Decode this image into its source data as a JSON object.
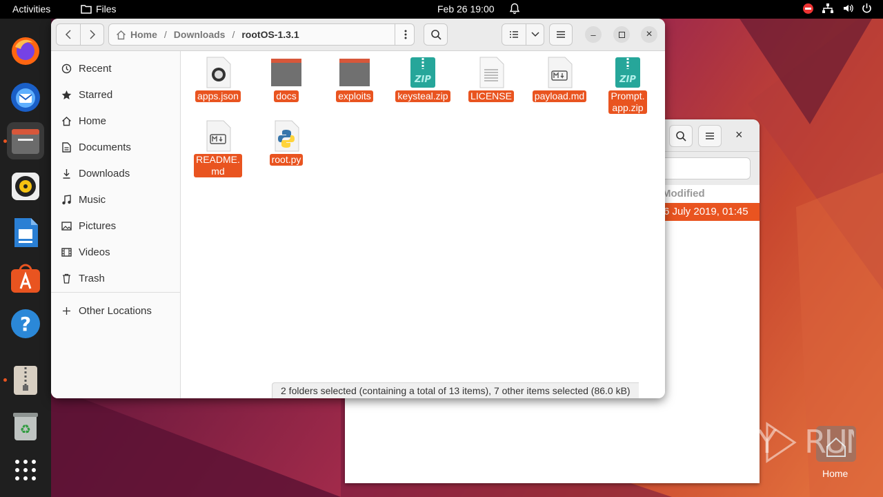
{
  "topbar": {
    "activities": "Activities",
    "app_name": "Files",
    "clock": "Feb 26  19:00"
  },
  "window": {
    "path": [
      {
        "label": "Home"
      },
      {
        "label": "Downloads"
      },
      {
        "label": "rootOS-1.3.1"
      }
    ],
    "sidebar": [
      {
        "label": "Recent",
        "icon": "clock-icon"
      },
      {
        "label": "Starred",
        "icon": "star-icon"
      },
      {
        "label": "Home",
        "icon": "home-icon"
      },
      {
        "label": "Documents",
        "icon": "document-icon"
      },
      {
        "label": "Downloads",
        "icon": "download-icon"
      },
      {
        "label": "Music",
        "icon": "music-icon"
      },
      {
        "label": "Pictures",
        "icon": "picture-icon"
      },
      {
        "label": "Videos",
        "icon": "video-icon"
      },
      {
        "label": "Trash",
        "icon": "trash-icon"
      }
    ],
    "other_locations": "Other Locations",
    "files": [
      {
        "name": "apps.json",
        "type": "json"
      },
      {
        "name": "docs",
        "type": "folder"
      },
      {
        "name": "exploits",
        "type": "folder"
      },
      {
        "name": "keysteal.zip",
        "type": "zip"
      },
      {
        "name": "LICENSE",
        "type": "text"
      },
      {
        "name": "payload.md",
        "type": "markdown"
      },
      {
        "name": "Prompt.\napp.zip",
        "type": "zip"
      },
      {
        "name": "README.\nmd",
        "type": "markdown"
      },
      {
        "name": "root.py",
        "type": "python"
      }
    ],
    "status": "2 folders selected (containing a total of 13 items), 7 other items selected (86.0 kB)"
  },
  "back_window": {
    "column_header": "Modified",
    "selected_row": "6 July 2019, 01:45"
  },
  "desktop": {
    "home_label": "Home",
    "watermark": "ANY RUN"
  },
  "colors": {
    "accent": "#e95420",
    "dock": "#1f1f1f",
    "topbar": "#000000"
  }
}
